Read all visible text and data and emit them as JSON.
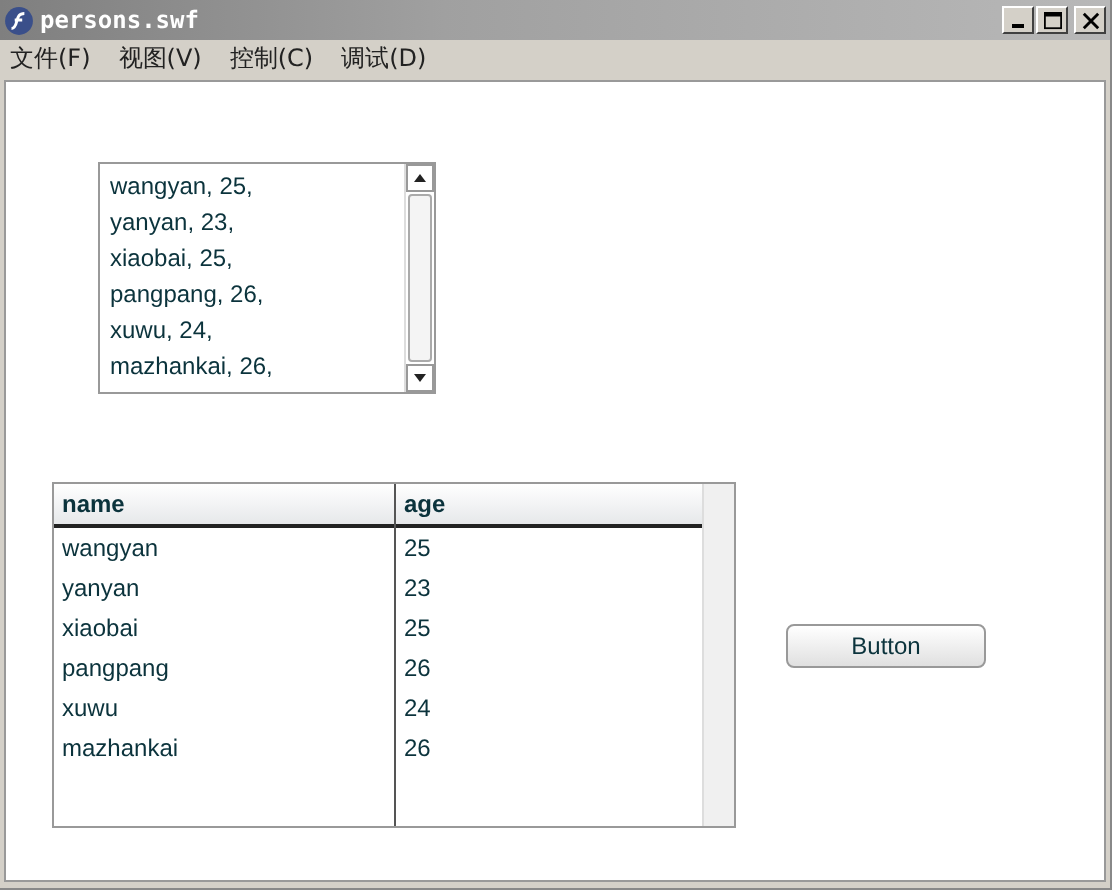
{
  "window": {
    "title": "persons.swf"
  },
  "menu": [
    "文件(F)",
    "视图(V)",
    "控制(C)",
    "调试(D)"
  ],
  "list": {
    "items": [
      "wangyan, 25,",
      "yanyan, 23,",
      "xiaobai, 25,",
      "pangpang, 26,",
      "xuwu, 24,",
      "mazhankai, 26,"
    ]
  },
  "table": {
    "columns": [
      "name",
      "age"
    ],
    "rows": [
      [
        "wangyan",
        "25"
      ],
      [
        "yanyan",
        "23"
      ],
      [
        "xiaobai",
        "25"
      ],
      [
        "pangpang",
        "26"
      ],
      [
        "xuwu",
        "24"
      ],
      [
        "mazhankai",
        "26"
      ]
    ]
  },
  "button": "Button"
}
